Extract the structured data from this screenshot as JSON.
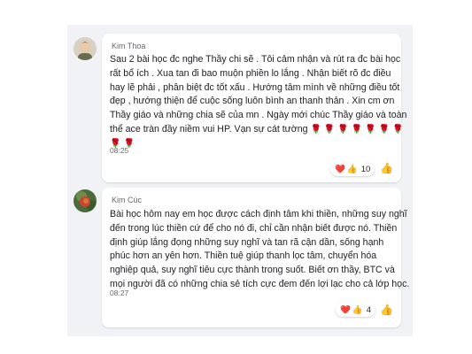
{
  "comments": [
    {
      "author": "Kim Thoa",
      "lines": [
        "Sau 2 bài học đc nghe Thầy chi sẽ . Tôi cảm nhận và rút ra đc bài học",
        "rất bổ ích . Xua tan đi bao muộn phiền lo lắng . Nhận biết rõ đc điều",
        "hay lẽ phải , phân biệt đc tốt xấu . Hướng tâm mình về những điều tốt",
        "đẹp , hướng thiện để cuộc sống luôn bình an thanh thản . Xin cm ơn",
        "Thầy giáo và những chia sẽ của mn . Ngày mới chúc Thầy giáo và toàn",
        "thể ace tràn đầy niềm vui HP. Vạn sự cát tường"
      ],
      "inline_roses": [
        "🌹",
        "🌹",
        "🌹",
        "🌹",
        "🌹",
        "🌹",
        "🌹"
      ],
      "extra_roses": [
        "🌹",
        "🌹"
      ],
      "time": "08:25",
      "reactions": {
        "icons": [
          "❤️",
          "👍"
        ],
        "count": "10"
      }
    },
    {
      "author": "Kim Cúc",
      "lines": [
        "Bài học hôm nay em học được cách định tâm khi thiền, những suy nghĩ",
        "đến trong lúc thiền cứ để cho nó đi, chỉ cần nhận biết được nó. Thiền",
        "định giúp lắng đọng những suy nghĩ và tan rã cận dần, sống hạnh",
        "phúc hơn an yên hơn. Thiền tuệ giúp thanh lọc tâm, chuyển hóa",
        "nghiệp quả, suy nghĩ tiêu cực thành trong suốt. Biết ơn thầy, BTC và",
        "mọi người đã có những chia sẻ tích cực đem đến lợi lạc cho cả lớp học."
      ],
      "time": "08:27",
      "reactions": {
        "icons": [
          "❤️",
          "👍"
        ],
        "count": "4"
      }
    }
  ],
  "like_icon": "👍"
}
